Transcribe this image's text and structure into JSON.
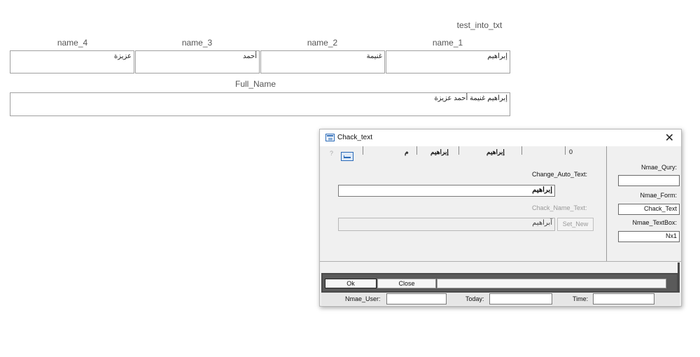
{
  "report": {
    "title": "test_into_txt",
    "name_headers": [
      "name_4",
      "name_3",
      "name_2",
      "name_1"
    ],
    "name_values": [
      "عزيزة",
      "أحمد",
      "غنيمة",
      "إبراهيم"
    ],
    "full_name_label": "Full_Name",
    "full_name_value": "إبراهيم غنيمة أحمد عزيزة"
  },
  "dialog": {
    "title": "Chack_text",
    "top_row": {
      "help": "?",
      "cell_1": "م",
      "cell_2": "إبراهيم",
      "cell_3": "إبراهيم",
      "cell_4": "0"
    },
    "change_auto_label": "Change_Auto_Text:",
    "change_auto_value": "إبراهيم",
    "chack_name_label": "Chack_Name_Text:",
    "chack_name_value": "آبراهيم",
    "set_new_label": "Set_New",
    "right_panel": {
      "query_label": "Nmae_Qury:",
      "query_value": "",
      "form_label": "Nmae_Form:",
      "form_value": "Chack_Text",
      "textbox_label": "Nmae_TextBox:",
      "textbox_value": "Nx1"
    },
    "ok_label": "Ok",
    "close_label": "Close",
    "status": {
      "user_label": "Nmae_User:",
      "today_label": "Today:",
      "time_label": "Time:"
    }
  }
}
